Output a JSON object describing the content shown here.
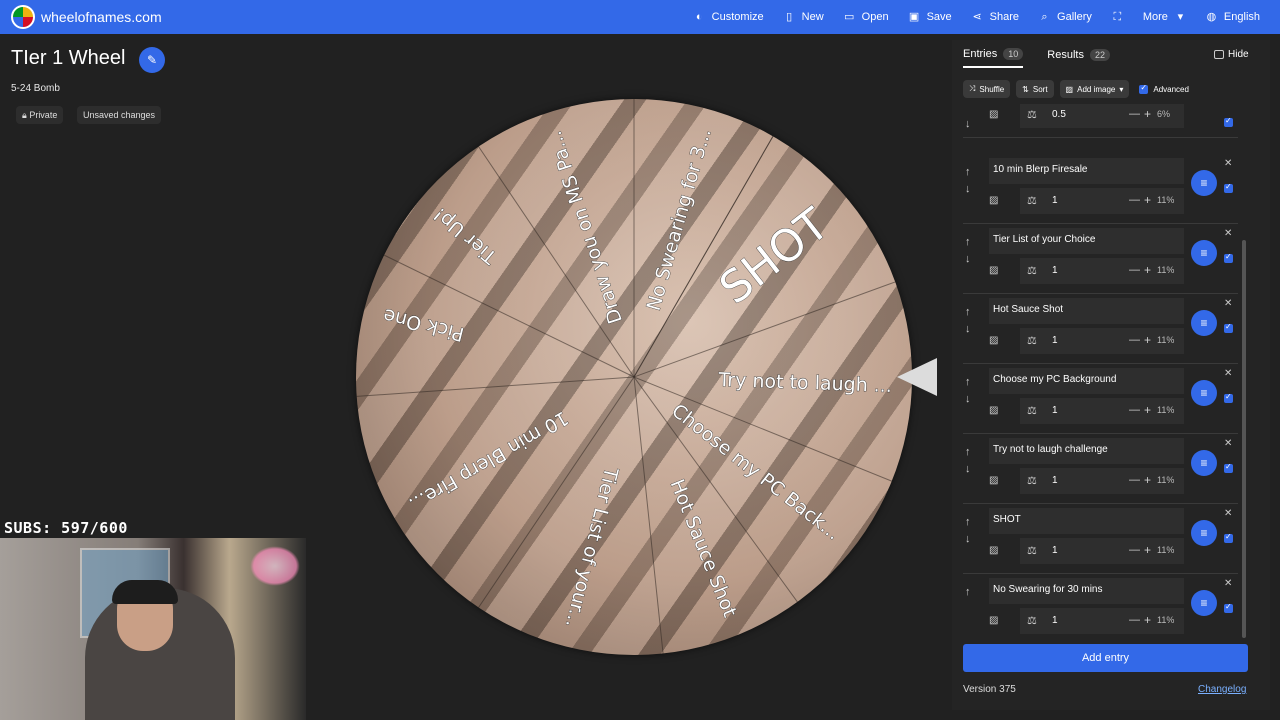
{
  "site": {
    "name": "wheelofnames.com"
  },
  "menu": [
    {
      "label": "Customize",
      "icon": "palette-icon"
    },
    {
      "label": "New",
      "icon": "file-icon"
    },
    {
      "label": "Open",
      "icon": "folder-icon"
    },
    {
      "label": "Save",
      "icon": "save-icon"
    },
    {
      "label": "Share",
      "icon": "share-icon"
    },
    {
      "label": "Gallery",
      "icon": "search-icon"
    },
    {
      "label": "",
      "icon": "fullscreen-icon"
    },
    {
      "label": "More",
      "icon": "chevron-down-icon"
    },
    {
      "label": "English",
      "icon": "globe-icon"
    }
  ],
  "wheel_info": {
    "title": "TIer 1 Wheel",
    "subtitle": "5-24 Bomb",
    "private_label": "Private",
    "unsaved_label": "Unsaved changes"
  },
  "wheel_segments": [
    "SHOT",
    "Try not to laugh ...",
    "Choose my PC Back...",
    "Hot Sauce Shot",
    "Tier List of your...",
    "10 min Blerp Fire...",
    "Pick One",
    "Tier Up!",
    "Draw you on MS Pa...",
    "No Swearing for 3..."
  ],
  "stream": {
    "subs": "SUBS: 597/600"
  },
  "panel": {
    "tabs": [
      {
        "label": "Entries",
        "count": "10"
      },
      {
        "label": "Results",
        "count": "22"
      }
    ],
    "hide_label": "Hide",
    "toolbar": {
      "shuffle": "Shuffle",
      "sort": "Sort",
      "add_image": "Add image",
      "advanced": "Advanced"
    },
    "entries": [
      {
        "name": "",
        "weight": "0.5",
        "percent": "6%"
      },
      {
        "name": "10 min Blerp Firesale",
        "weight": "1",
        "percent": "11%"
      },
      {
        "name": "Tier List of your Choice",
        "weight": "1",
        "percent": "11%"
      },
      {
        "name": "Hot Sauce Shot",
        "weight": "1",
        "percent": "11%"
      },
      {
        "name": "Choose my PC Background",
        "weight": "1",
        "percent": "11%"
      },
      {
        "name": "Try not to laugh challenge",
        "weight": "1",
        "percent": "11%"
      },
      {
        "name": "SHOT",
        "weight": "1",
        "percent": "11%"
      },
      {
        "name": "No Swearing for 30 mins",
        "weight": "1",
        "percent": "11%"
      }
    ],
    "add_entry": "Add entry",
    "version": "Version 375",
    "changelog": "Changelog"
  },
  "colors": {
    "accent": "#3369e8",
    "background": "#212121",
    "panel": "#242424"
  }
}
